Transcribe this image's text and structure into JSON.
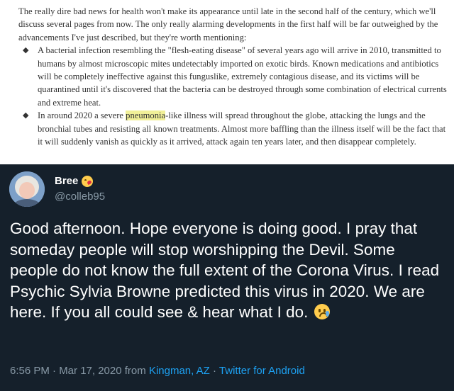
{
  "excerpt": {
    "intro": "The really dire bad news for health won't make its appearance until late in the second half of the century, which we'll discuss several pages from now. The only really alarming developments in the first half will be far outweighed by the advancements I've just described, but they're worth mentioning:",
    "bullet_symbol": "◆",
    "bullets": [
      "A bacterial infection resembling the \"flesh-eating disease\" of several years ago will arrive in 2010, transmitted to humans by almost microscopic mites undetectably imported on exotic birds. Known medications and antibiotics will be completely ineffective against this funguslike, extremely contagious disease, and its victims will be quarantined until it's discovered that the bacteria can be destroyed through some combination of electrical currents and extreme heat."
    ],
    "bullet2_before": "In around 2020 a severe ",
    "bullet2_highlight": "pneumonia",
    "bullet2_after": "-like illness will spread throughout the globe, attacking the lungs and the bronchial tubes and resisting all known treatments. Almost more baffling than the illness itself will be the fact that it will suddenly vanish as quickly as it arrived, attack again ten years later, and then disappear completely.",
    "highlight_color": "#f1f098"
  },
  "tweet": {
    "display_name": "Bree",
    "handle": "@colleb95",
    "text": "Good afternoon. Hope everyone is doing good.  I pray that someday people will stop worshipping the Devil. Some people do not know the full extent of the Corona Virus. I read Psychic Sylvia Browne predicted this virus in 2020. We are here. If you all could see & hear what I do.",
    "name_emoji": "face-blowing-kiss-icon",
    "text_emoji": "crying-face-icon",
    "time_date": "6:56 PM · Mar 17, 2020",
    "from_label": "from",
    "location": "Kingman, AZ",
    "separator": "·",
    "source": "Twitter for Android",
    "colors": {
      "background": "#15202b",
      "secondary_text": "#8899a6",
      "link": "#1da1f2"
    }
  }
}
